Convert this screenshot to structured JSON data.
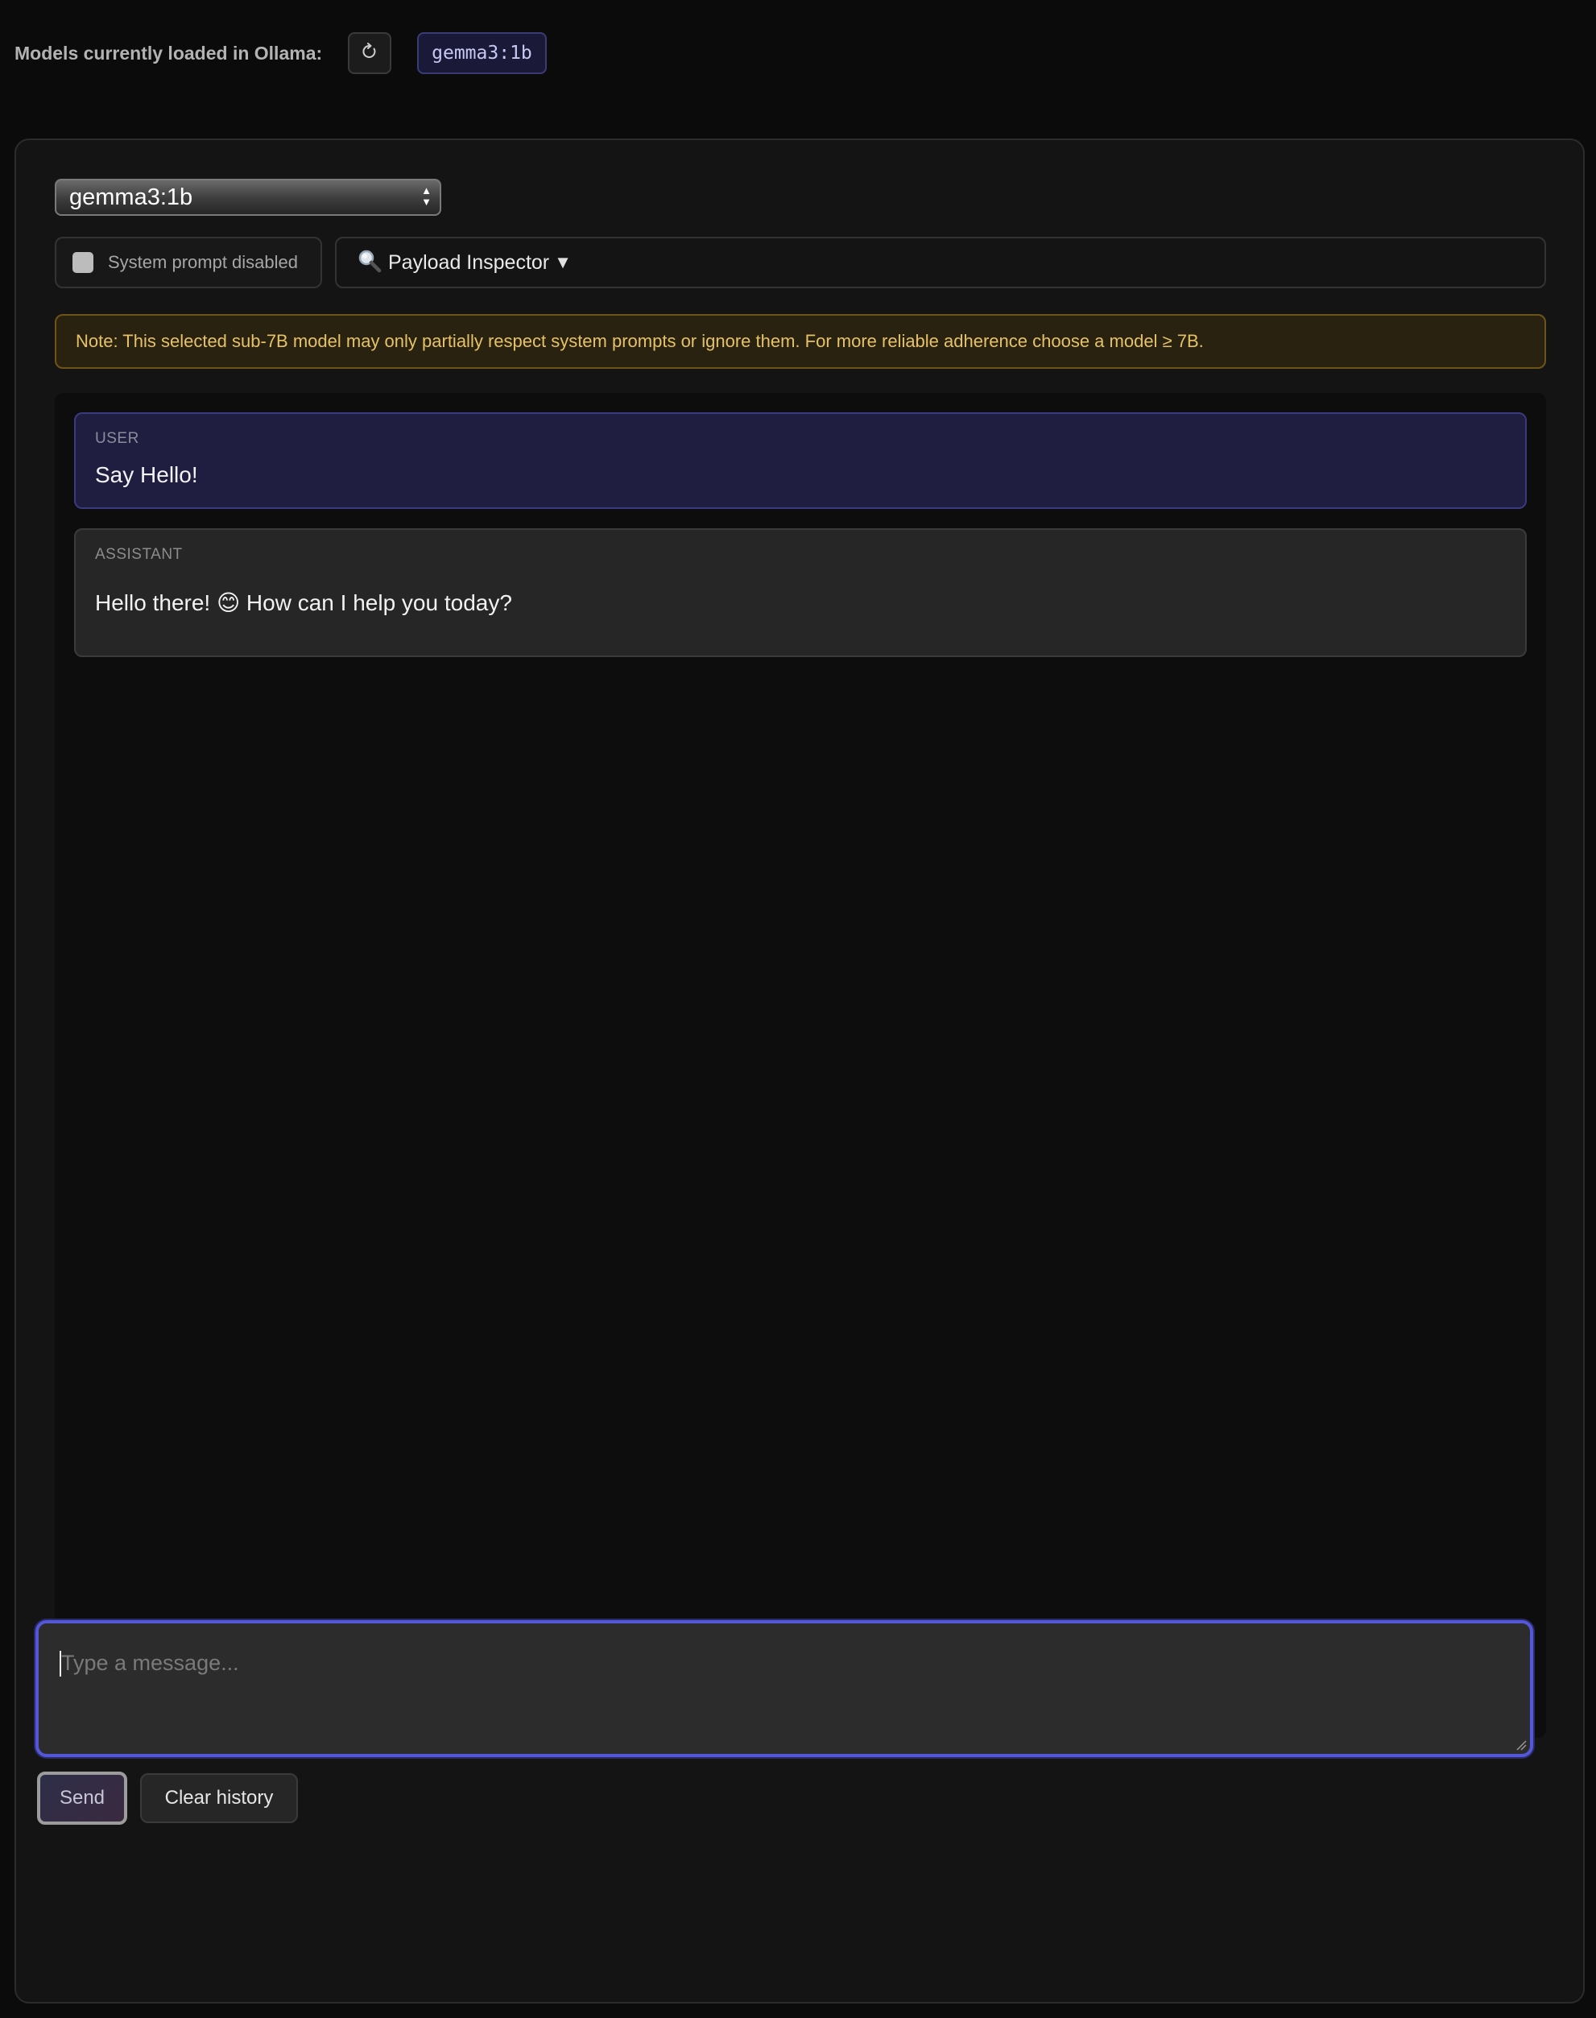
{
  "header": {
    "loaded_label": "Models currently loaded in Ollama:",
    "refresh_icon": "refresh-icon",
    "loaded_models": [
      "gemma3:1b"
    ]
  },
  "controls": {
    "model_select_value": "gemma3:1b",
    "system_prompt_label": "System prompt disabled",
    "system_prompt_enabled": false,
    "inspector_icon": "magnifier-icon",
    "inspector_label": "Payload Inspector",
    "inspector_caret": "▼"
  },
  "note": "Note: This selected sub-7B model may only partially respect system prompts or ignore them. For more reliable adherence choose a model ≥ 7B.",
  "messages": [
    {
      "role": "USER",
      "content": "Say Hello!"
    },
    {
      "role": "ASSISTANT",
      "content": "Hello there! 😊 How can I help you today?"
    }
  ],
  "composer": {
    "placeholder": "Type a message..."
  },
  "actions": {
    "send_label": "Send",
    "clear_label": "Clear history"
  },
  "colors": {
    "accent": "#5457d6",
    "user_bubble": "#1f1e40",
    "note_text": "#e6c266"
  }
}
